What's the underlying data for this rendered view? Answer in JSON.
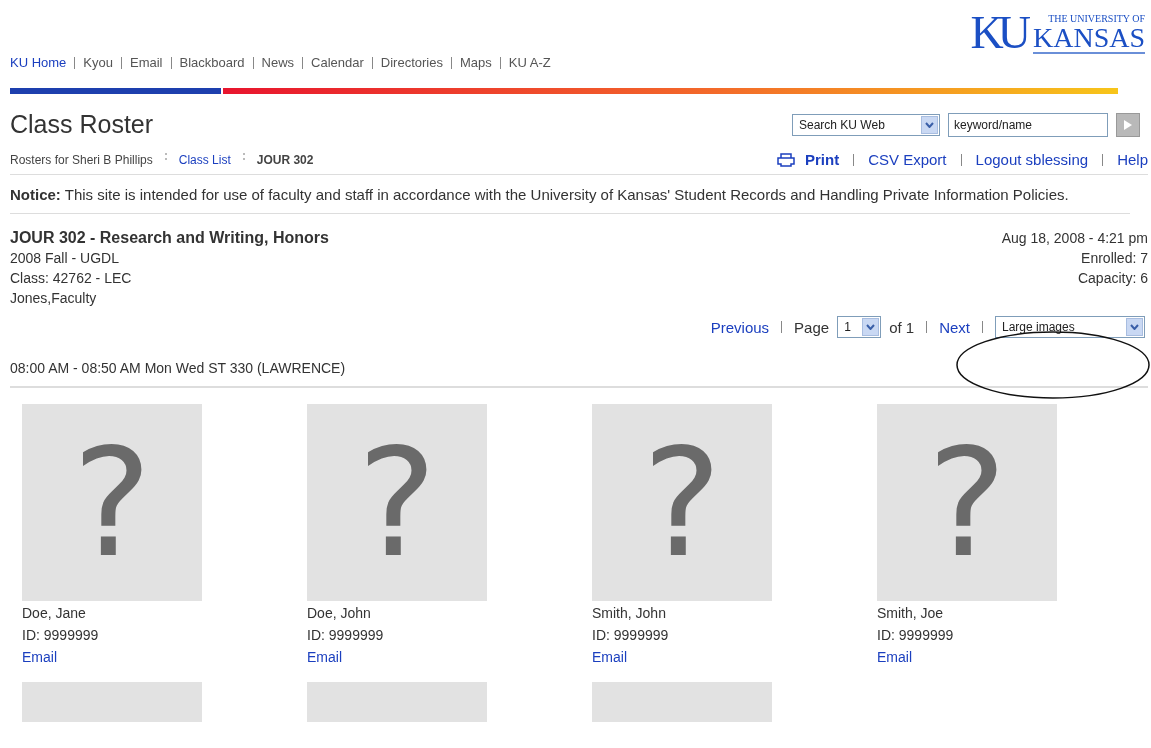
{
  "logo": {
    "mark": "KU",
    "small": "THE UNIVERSITY OF",
    "big": "KANSAS"
  },
  "nav": [
    "KU Home",
    "Kyou",
    "Email",
    "Blackboard",
    "News",
    "Calendar",
    "Directories",
    "Maps",
    "KU A-Z"
  ],
  "title": "Class Roster",
  "search": {
    "scope": "Search KU Web",
    "placeholder": "keyword/name"
  },
  "breadcrumb": [
    {
      "label": "Rosters for Sheri B Phillips",
      "kind": "text"
    },
    {
      "label": "Class List",
      "kind": "link"
    },
    {
      "label": "JOUR 302",
      "kind": "current"
    }
  ],
  "actions": [
    "Print",
    "CSV Export",
    "Logout sblessing",
    "Help"
  ],
  "notice": "**Notice:** This site is intended for use of faculty and staff in accordance with the University of Kansas' Student Records and Handling Private Information Policies.",
  "course": {
    "title": "JOUR 302 - Research and Writing, Honors",
    "lines": [
      "2008 Fall - UGDL",
      "Class: 42762 - LEC",
      "Jones,Faculty"
    ],
    "stats": [
      "Aug 18, 2008 - 4:21 pm",
      "Enrolled: 7",
      "Capacity: 6"
    ]
  },
  "pager": {
    "previous": "Previous",
    "page_label": "Page",
    "page": "1",
    "of": "of 1",
    "next": "Next",
    "view": "Large images"
  },
  "schedule": "08:00 AM - 08:50 AM Mon Wed ST 330 (LAWRENCE)",
  "students": [
    {
      "photo": "?",
      "name": "Doe, Jane",
      "id": "ID: 9999999",
      "email": "Email"
    },
    {
      "photo": "?",
      "name": "Doe, John",
      "id": "ID: 9999999",
      "email": "Email"
    },
    {
      "photo": "?",
      "name": "Smith, John",
      "id": "ID: 9999999",
      "email": "Email"
    },
    {
      "photo": "?",
      "name": "Smith, Joe",
      "id": "ID: 9999999",
      "email": "Email"
    }
  ],
  "more_photos": [
    {
      "kind": "photo"
    },
    {
      "kind": "photo"
    },
    {
      "kind": "photo"
    }
  ]
}
